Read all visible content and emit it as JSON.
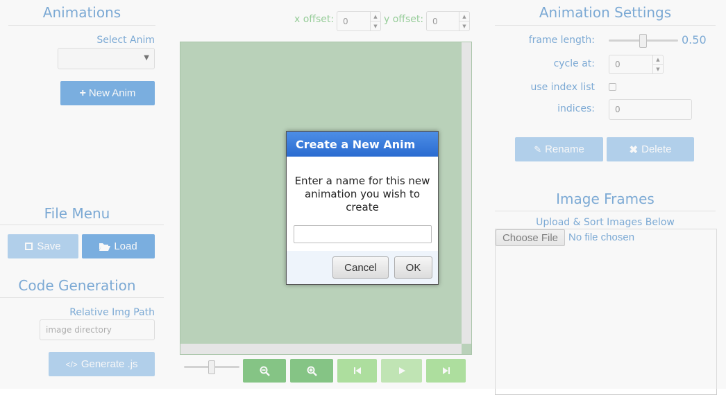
{
  "left": {
    "animations_title": "Animations",
    "select_label": "Select Anim",
    "new_anim_label": "New Anim",
    "file_menu_title": "File Menu",
    "save_label": "Save",
    "load_label": "Load",
    "code_gen_title": "Code Generation",
    "img_path_label": "Relative Img Path",
    "img_path_placeholder": "image directory",
    "generate_label": "Generate .js"
  },
  "canvas": {
    "x_offset_label": "x offset:",
    "x_offset_value": "0",
    "y_offset_label": "y offset:",
    "y_offset_value": "0",
    "bg_color": "#8db88d"
  },
  "right": {
    "settings_title": "Animation Settings",
    "frame_length_label": "frame length:",
    "frame_length_value": "0.50",
    "cycle_at_label": "cycle at:",
    "cycle_at_value": "0",
    "use_index_label": "use index list",
    "indices_label": "indices:",
    "indices_value": "0",
    "rename_label": "Rename",
    "delete_label": "Delete",
    "image_frames_title": "Image Frames",
    "upload_label": "Upload & Sort Images Below",
    "choose_file_label": "Choose File",
    "no_file_label": "No file chosen"
  },
  "dialog": {
    "title": "Create a New Anim",
    "message": "Enter a name for this new animation you wish to create",
    "input_value": "",
    "cancel_label": "Cancel",
    "ok_label": "OK"
  }
}
